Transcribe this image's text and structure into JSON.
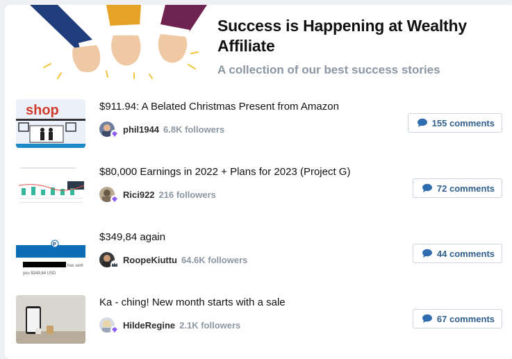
{
  "header": {
    "title": "Success is Happening at Wealthy Affiliate",
    "subtitle": "A collection of our best success stories"
  },
  "stories": [
    {
      "title": "$911.94: A Belated Christmas Present from Amazon",
      "author": "phil1944",
      "followers": "6.8K followers",
      "comments": "155 comments",
      "thumb_text": "shop"
    },
    {
      "title": "$80,000 Earnings in 2022 + Plans for 2023 (Project G)",
      "author": "Rici922",
      "followers": "216 followers",
      "comments": "72 comments"
    },
    {
      "title": "$349,84 again",
      "author": "RoopeKiuttu",
      "followers": "64.6K followers",
      "comments": "44 comments",
      "thumb_text": "has sent you $349,84 USD"
    },
    {
      "title": "Ka - ching! New month starts with a sale",
      "author": "HildeRegine",
      "followers": "2.1K followers",
      "comments": "67 comments"
    }
  ],
  "colors": {
    "accent_blue": "#2f5f8d",
    "muted": "#8a96a3",
    "badge_purple": "#8b5cf6"
  },
  "icons": {
    "comment": "comment-bubble-icon",
    "badge": "membership-badge-icon"
  }
}
